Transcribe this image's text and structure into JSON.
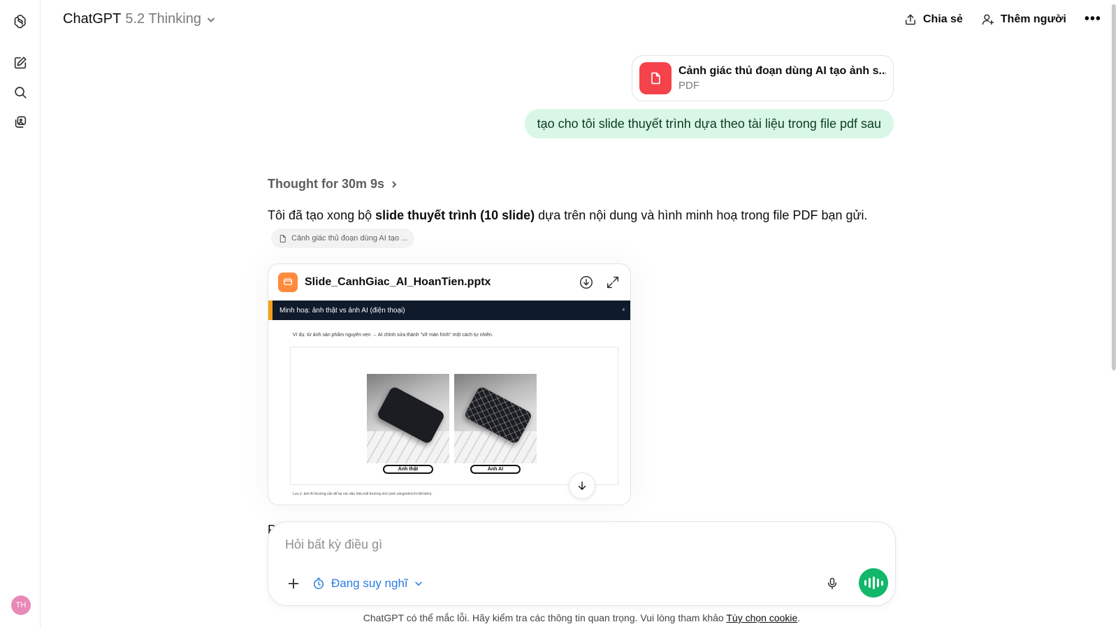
{
  "header": {
    "model_name": "ChatGPT",
    "model_version": "5.2 Thinking",
    "share_label": "Chia sẻ",
    "add_people_label": "Thêm người",
    "more_label": "•••"
  },
  "sidebar": {
    "icons": [
      "openai-logo-icon",
      "new-chat-icon",
      "search-icon",
      "library-icon"
    ],
    "avatar_initials": "TH",
    "avatar_color": "#e889b8"
  },
  "conversation": {
    "user_file": {
      "name": "Cảnh giác thủ đoạn dùng AI tạo ảnh s...",
      "type": "PDF"
    },
    "user_message": "tạo cho tôi slide thuyết trình dựa theo tài liệu trong file pdf sau",
    "thought_label": "Thought for 30m 9s",
    "answer": {
      "prefix": "Tôi đã tạo xong bộ ",
      "bold": "slide thuyết trình (10 slide)",
      "suffix": " dựa trên nội dung và hình minh hoạ trong file PDF bạn gửi."
    },
    "source_chip": "Cảnh giác thủ đoạn dùng AI tạo ...",
    "attachment": {
      "filename": "Slide_CanhGiac_AI_HoanTien.pptx",
      "slide": {
        "title": "Minh hoạ: ảnh thật vs ảnh AI (điện thoại)",
        "number": "4",
        "subtitle": "Ví dụ: từ ảnh sản phẩm nguyên vẹn → AI chỉnh sửa thành \"vỡ màn hình\" một cách tự nhiên.",
        "left_label": "Ảnh thật",
        "right_label": "Ảnh AI",
        "note": "Lưu ý: ảnh AI thường vẫn để lại các dấu hiệu bất thường nhỏ (ánh sáng/viền/chi tiết biên)."
      }
    },
    "stray_text": "P"
  },
  "composer": {
    "placeholder": "Hỏi bất kỳ điều gì",
    "mode_label": "Đang suy nghĩ"
  },
  "footer": {
    "text": "ChatGPT có thể mắc lỗi. Hãy kiểm tra các thông tin quan trọng. Vui lòng tham khảo ",
    "link": "Tùy chọn cookie",
    "end": "."
  },
  "colors": {
    "accent_blue": "#2a7de1",
    "voice_green": "#12b76a",
    "pdf_red": "#f5424b",
    "pptx_orange": "#ff8a3d",
    "user_bubble": "#d9f7e6"
  }
}
